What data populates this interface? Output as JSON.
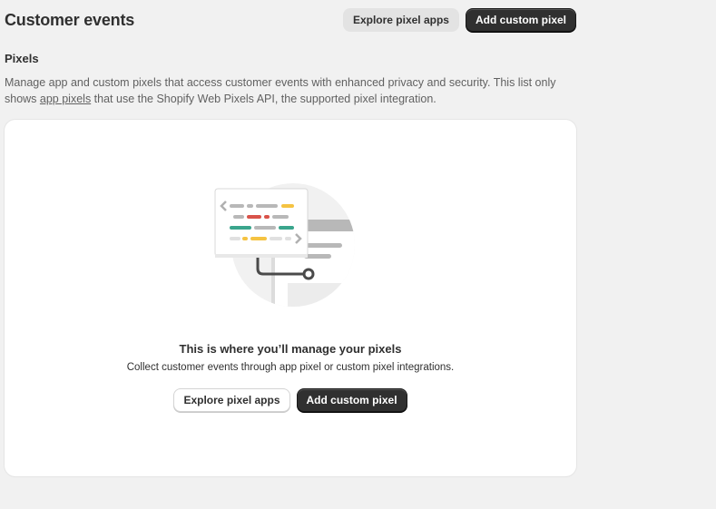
{
  "header": {
    "title": "Customer events",
    "explore_label": "Explore pixel apps",
    "add_label": "Add custom pixel"
  },
  "pixels": {
    "heading": "Pixels",
    "desc_part1": "Manage app and custom pixels that access customer events with enhanced privacy and security. This list only shows ",
    "desc_link": "app pixels",
    "desc_part2": " that use the Shopify Web Pixels API, the supported pixel integration."
  },
  "empty_state": {
    "illustration_icon": "pixel-code-illustration-icon",
    "title": "This is where you’ll manage your pixels",
    "description": "Collect customer events through app pixel or custom pixel integrations.",
    "explore_label": "Explore pixel apps",
    "add_label": "Add custom pixel"
  },
  "colors": {
    "background": "#f1f1f1",
    "primary_button": "#303030",
    "accent_yellow": "#f5c342",
    "accent_red": "#d9534a",
    "accent_teal": "#3aa58c"
  }
}
